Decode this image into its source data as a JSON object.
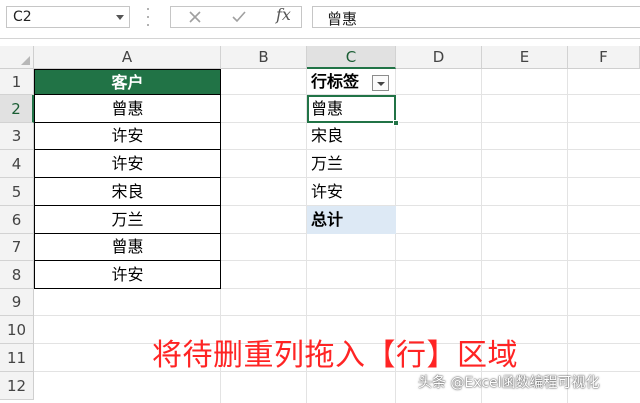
{
  "formula_bar": {
    "name_box": "C2",
    "fx_label": "fx",
    "formula_value": "曾惠"
  },
  "column_headers": [
    "A",
    "B",
    "C",
    "D",
    "E",
    "F"
  ],
  "row_headers": [
    "1",
    "2",
    "3",
    "4",
    "5",
    "6",
    "7",
    "8",
    "9",
    "10",
    "11",
    "12"
  ],
  "source_table": {
    "header": "客户",
    "values": [
      "曾惠",
      "许安",
      "许安",
      "宋良",
      "万兰",
      "曾惠",
      "许安"
    ]
  },
  "pivot_table": {
    "header": "行标签",
    "items": [
      "曾惠",
      "宋良",
      "万兰",
      "许安"
    ],
    "total_label": "总计"
  },
  "annotation": "将待删重列拖入【行】区域",
  "watermark": "头条 @Excel函数编程可视化",
  "colors": {
    "accent_green": "#217346",
    "annotation_red": "#ff2424",
    "pivot_total_bg": "#dde9f5"
  }
}
